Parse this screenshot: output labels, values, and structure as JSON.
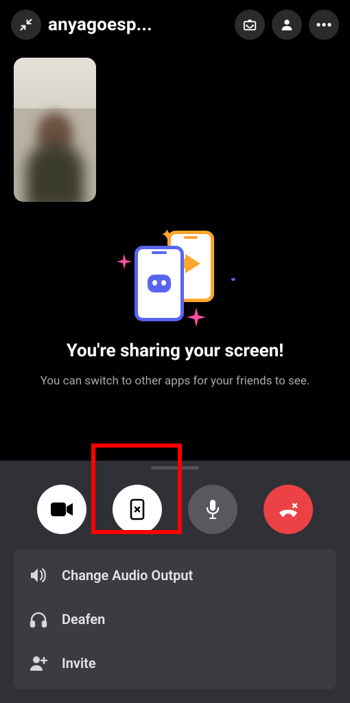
{
  "header": {
    "title": "anyagoesp..."
  },
  "promo": {
    "heading": "You're sharing your screen!",
    "sub": "You can switch to other apps for your friends to see."
  },
  "menu": {
    "items": [
      {
        "label": "Change Audio Output"
      },
      {
        "label": "Deafen"
      },
      {
        "label": "Invite"
      }
    ]
  }
}
